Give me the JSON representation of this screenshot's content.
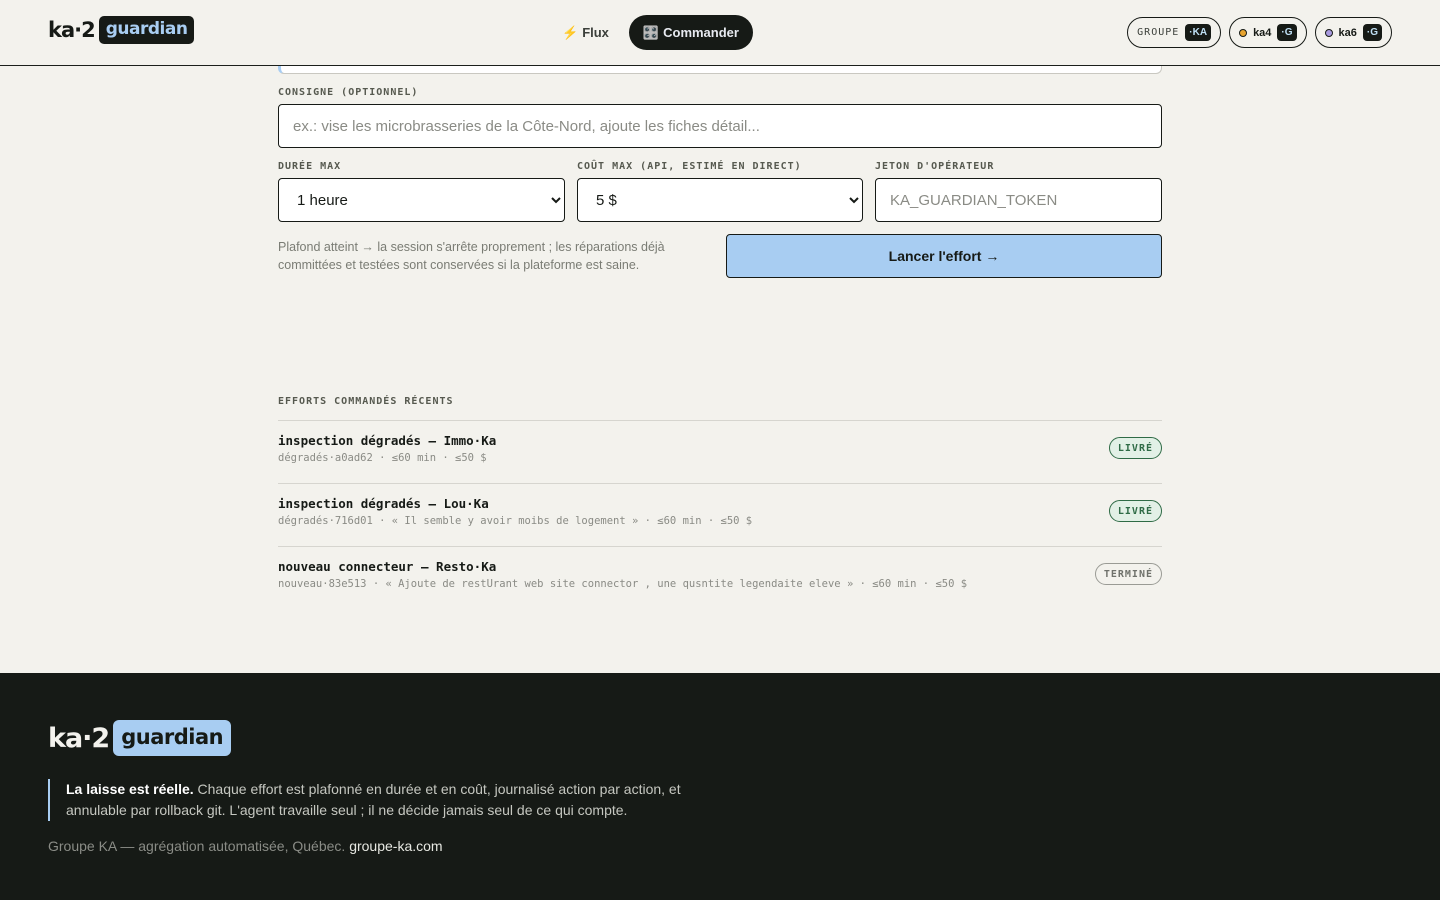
{
  "header": {
    "brand_ka": "ka·2",
    "brand_guardian": "guardian",
    "nav": [
      {
        "icon": "bolt-icon",
        "glyph": "⚡",
        "label": "Flux"
      },
      {
        "icon": "grid-icon",
        "glyph": "🎛️",
        "label": "Commander"
      }
    ],
    "pills": [
      {
        "label": "GROUPE",
        "chip": "·KA"
      },
      {
        "label": "ka4",
        "chip": "·G",
        "dot_color": "#e8a42f"
      },
      {
        "label": "ka6",
        "chip": "·G",
        "dot_color": "#a99be0"
      }
    ]
  },
  "form": {
    "consigne_label": "CONSIGNE (OPTIONNEL)",
    "consigne_placeholder": "ex.: vise les microbrasseries de la Côte-Nord, ajoute les fiches détail...",
    "duree_label": "DURÉE MAX",
    "duree_value": "1 heure",
    "cout_label": "COÛT MAX (API, ESTIMÉ EN DIRECT)",
    "cout_value": "5 $",
    "jeton_label": "JETON D'OPÉRATEUR",
    "jeton_placeholder": "KA_GUARDIAN_TOKEN",
    "hint": "Plafond atteint → la session s'arrête proprement ; les réparations déjà committées et testées sont conservées si la plateforme est saine.",
    "launch_label": "Lancer l'effort →"
  },
  "recent": {
    "title": "EFFORTS COMMANDÉS RÉCENTS",
    "rows": [
      {
        "title": "inspection dégradés — Immo·Ka",
        "meta": "dégradés·a0ad62 · ≤60 min · ≤50 $",
        "status": "LIVRÉ"
      },
      {
        "title": "inspection dégradés — Lou·Ka",
        "meta": "dégradés·716d01 · « Il semble y avoir moibs de logement » · ≤60 min · ≤50 $",
        "status": "LIVRÉ"
      },
      {
        "title": "nouveau connecteur — Resto·Ka",
        "meta": "nouveau·83e513 · « Ajoute de restUrant web site connector , une qusntite legendaite eleve » · ≤60 min · ≤50 $",
        "status": "TERMINÉ"
      }
    ]
  },
  "footer": {
    "brand_ka": "ka·2",
    "brand_guardian": "guardian",
    "quote_bold": "La laisse est réelle.",
    "quote_rest": " Chaque effort est plafonné en durée et en coût, journalisé action par action, et annulable par rollback git. L'agent travaille seul ; il ne décide jamais seul de ce qui compte.",
    "credit": "Groupe KA — agrégation automatisée, Québec. ",
    "credit_link": "groupe-ka.com"
  },
  "colors": {
    "accent": "#a8cdf2",
    "dark": "#161a16",
    "background": "#f3f2ed",
    "status_ok": "#2f6b46"
  }
}
